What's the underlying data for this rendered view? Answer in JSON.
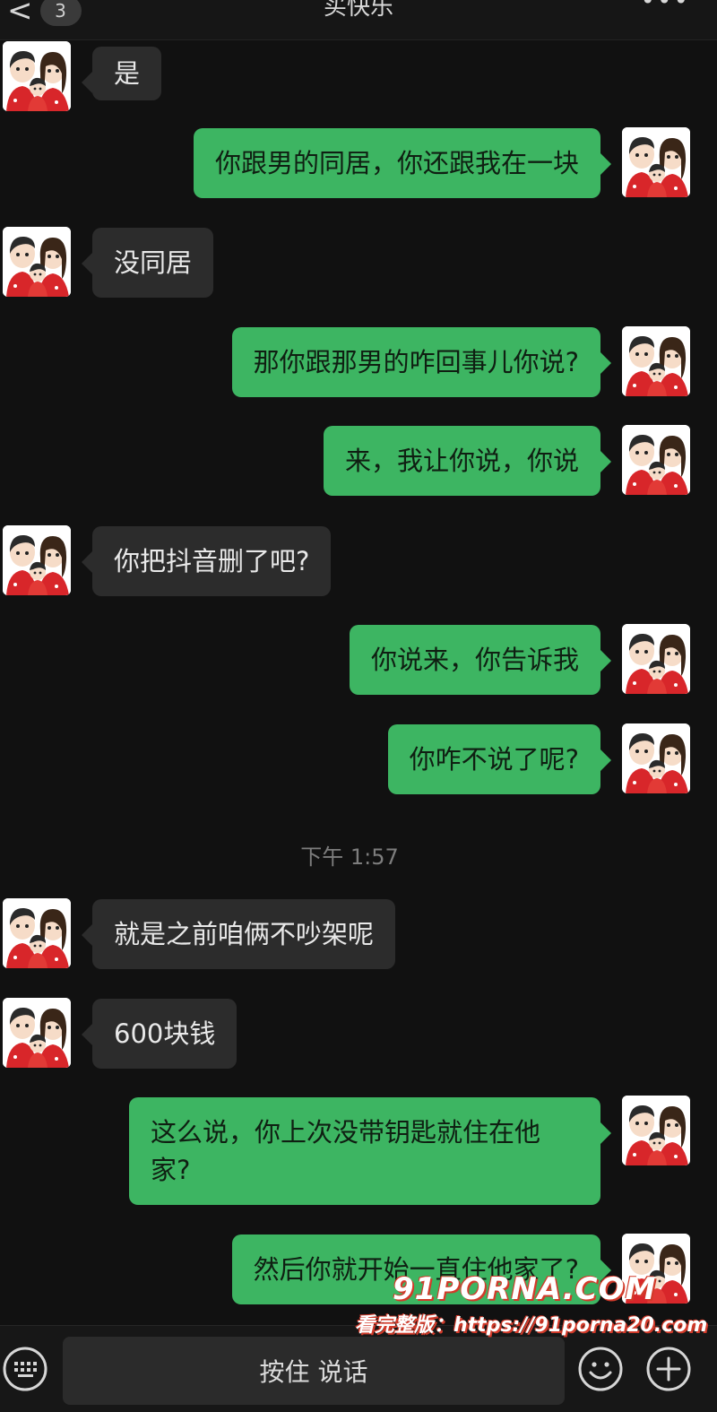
{
  "header": {
    "back_label": "<",
    "unread_count": "3",
    "title": "买快乐",
    "more_label": "•••"
  },
  "messages": [
    {
      "side": "in",
      "text": "是"
    },
    {
      "side": "out",
      "text": "你跟男的同居，你还跟我在一块"
    },
    {
      "side": "in",
      "text": "没同居"
    },
    {
      "side": "out",
      "text": "那你跟那男的咋回事儿你说?"
    },
    {
      "side": "out",
      "text": "来，我让你说，你说"
    },
    {
      "side": "in",
      "text": "你把抖音删了吧?"
    },
    {
      "side": "out",
      "text": "你说来，你告诉我"
    },
    {
      "side": "out",
      "text": "你咋不说了呢?"
    },
    {
      "side": "in",
      "text": "就是之前咱俩不吵架呢"
    },
    {
      "side": "in",
      "text": "600块钱"
    },
    {
      "side": "out",
      "text": "这么说，你上次没带钥匙就住在他家?"
    },
    {
      "side": "out",
      "text": "然后你就开始一直住他家了?"
    }
  ],
  "timestamp": "下午 1:57",
  "input_bar": {
    "hold_to_talk_label": "按住 说话",
    "keyboard_icon": "keyboard-icon",
    "emoji_icon": "emoji-icon",
    "plus_icon": "plus-icon"
  },
  "watermark": {
    "logo": "91PORNA.COM",
    "url": "看完整版：https://91porna20.com"
  },
  "colors": {
    "background": "#111111",
    "incoming_bubble": "#2c2c2c",
    "outgoing_bubble": "#3db562",
    "watermark_accent": "#d23a2a"
  }
}
